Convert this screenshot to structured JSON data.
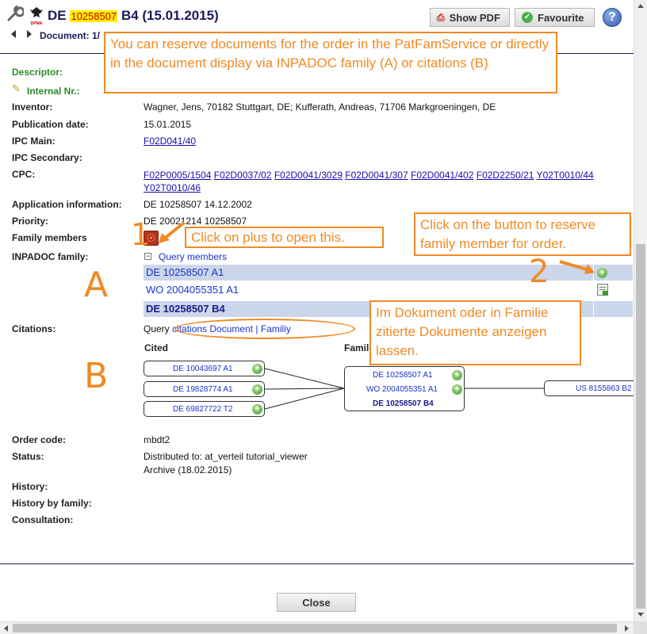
{
  "header": {
    "doc_prefix": "DE",
    "doc_number_highlight": "10258507",
    "doc_suffix": "B4 (15.01.2015)",
    "document_nav_label": "Document: 1/",
    "show_pdf_label": "Show PDF",
    "favourite_label": "Favourite",
    "help_label": "?",
    "logo_text": "DPMA"
  },
  "fields": {
    "descriptor_label": "Descriptor:",
    "internal_nr_label": "Internal Nr.:",
    "inventor_label": "Inventor:",
    "inventor_value": "Wagner, Jens, 70182 Stuttgart, DE; Kufferath, Andreas, 71706 Markgroeningen, DE",
    "publication_date_label": "Publication date:",
    "publication_date_value": "15.01.2015",
    "ipc_main_label": "IPC Main:",
    "ipc_main_value": "F02D041/40",
    "ipc_secondary_label": "IPC Secondary:",
    "cpc_label": "CPC:",
    "cpc_values": [
      "F02P0005/1504",
      "F02D0037/02",
      "F02D0041/3029",
      "F02D0041/307",
      "F02D0041/402",
      "F02D2250/21",
      "Y02T0010/44",
      "Y02T0010/46"
    ],
    "application_info_label": "Application information:",
    "application_info_value": "DE 10258507 14.12.2002",
    "priority_label": "Priority:",
    "priority_value": "DE 20021214 10258507",
    "family_members_label": "Family members",
    "inpadoc_label": "INPADOC family:",
    "query_members_label": "Query members",
    "inpadoc_rows": [
      "DE 10258507 A1",
      "WO 2004055351 A1",
      "DE 10258507 B4"
    ],
    "citations_label": "Citations:",
    "citations_query": "Query",
    "citations_link_document": "citations Document",
    "citations_separator": "|",
    "citations_link_family": "Familiy",
    "cited_header": "Cited",
    "family_header": "Famil",
    "order_code_label": "Order code:",
    "order_code_value": "mbdt2",
    "status_label": "Status:",
    "status_line1": "Distributed to: at_verteil tutorial_viewer",
    "status_line2": "Archive (18.02.2015)",
    "history_label": "History:",
    "history_family_label": "History by family:",
    "consultation_label": "Consultation:"
  },
  "graph": {
    "cited_nodes": [
      "DE 10043697 A1",
      "DE 19828774 A1",
      "DE 69827722 T2"
    ],
    "family_nodes": [
      "DE 10258507 A1",
      "WO 2004055351 A1",
      "DE 10258507 B4"
    ],
    "citing_nodes": [
      "US 8155863 B2"
    ]
  },
  "annotations": {
    "callout_top": "You can reserve documents for the order in the PatFamService or directly in the document display via INPADOC family (A) or citations (B)",
    "callout_plus": "Click on plus to open this.",
    "callout_reserve": "Click on the button to reserve family member for order.",
    "callout_german": "Im Dokument oder in Familie zitierte Dokumente anzeigen lassen.",
    "marker_1": "1",
    "marker_2": "2",
    "marker_A": "A",
    "marker_B": "B"
  },
  "footer": {
    "close_label": "Close"
  },
  "colors": {
    "accent_orange": "#f08a24",
    "header_navy": "#1a1a5a",
    "row_highlight": "#ccd6ea",
    "link_blue": "#1a0dab"
  }
}
